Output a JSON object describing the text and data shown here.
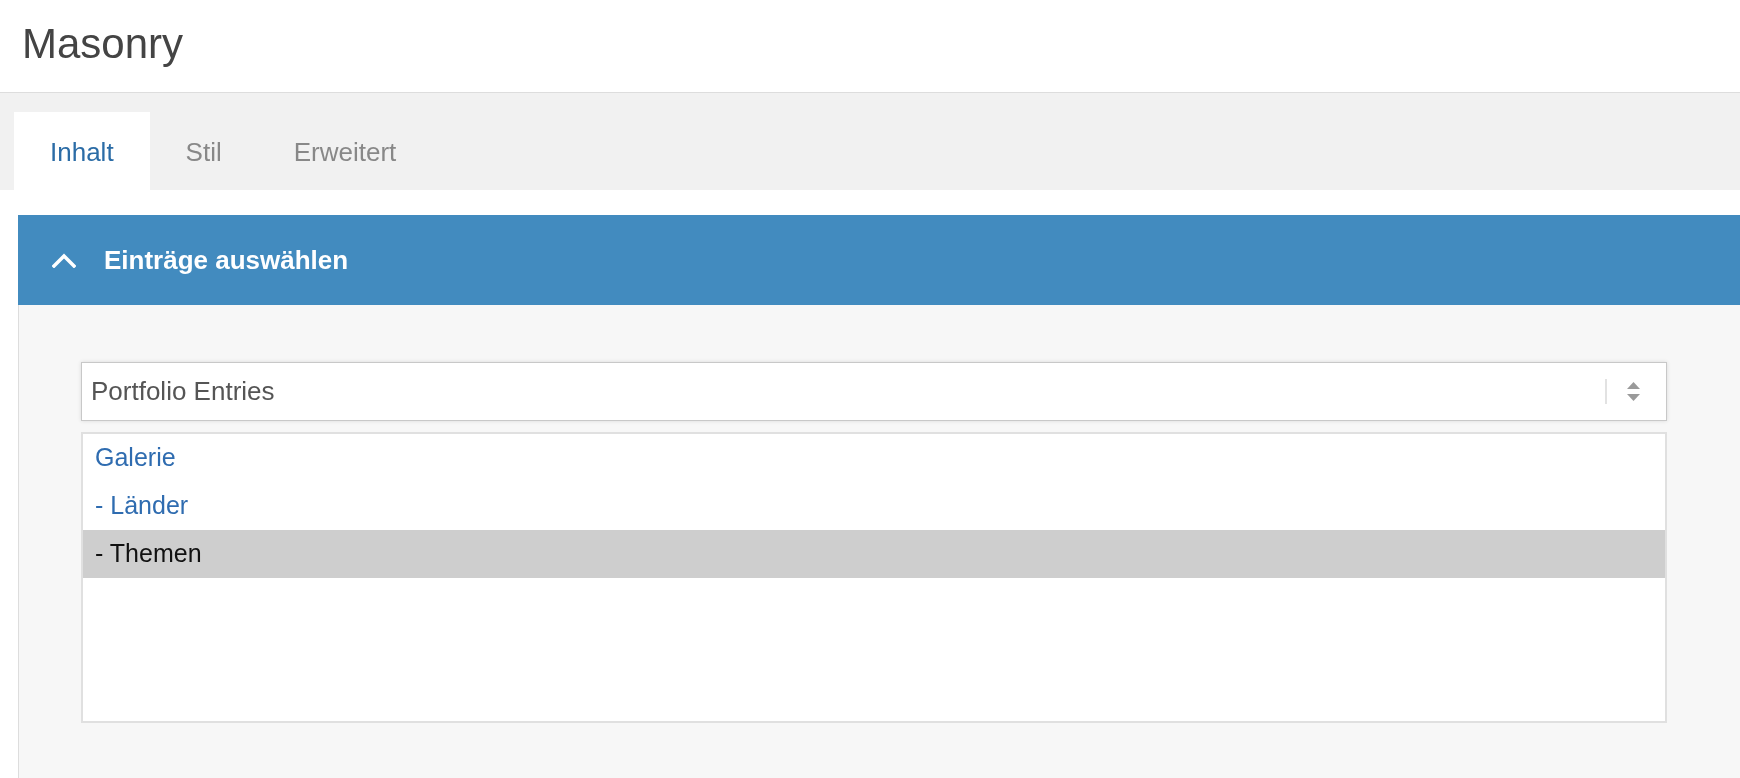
{
  "page": {
    "title": "Masonry"
  },
  "tabs": [
    {
      "label": "Inhalt",
      "selected": true
    },
    {
      "label": "Stil",
      "selected": false
    },
    {
      "label": "Erweitert",
      "selected": false
    }
  ],
  "section": {
    "title": "Einträge auswählen",
    "expanded": true,
    "source_select": {
      "value": "Portfolio Entries"
    },
    "category_list": [
      {
        "label": "Galerie",
        "selected": true,
        "highlighted": false
      },
      {
        "label": "- Länder",
        "selected": true,
        "highlighted": false
      },
      {
        "label": "- Themen",
        "selected": false,
        "highlighted": true
      }
    ]
  }
}
